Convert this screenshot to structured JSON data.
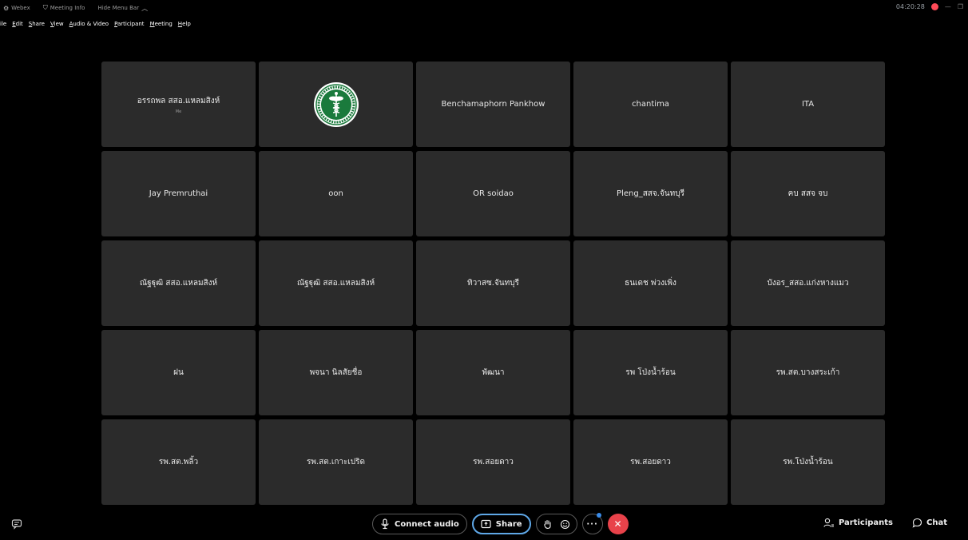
{
  "titlebar": {
    "app_name": "Webex",
    "meeting_info": "Meeting Info",
    "hide_menu_bar": "Hide Menu Bar",
    "clock": "04:20:28"
  },
  "menu": [
    {
      "first": "F",
      "rest": "ile"
    },
    {
      "first": "E",
      "rest": "dit"
    },
    {
      "first": "S",
      "rest": "hare"
    },
    {
      "first": "V",
      "rest": "iew"
    },
    {
      "first": "A",
      "rest": "udio & Video"
    },
    {
      "first": "P",
      "rest": "articipant"
    },
    {
      "first": "M",
      "rest": "eeting"
    },
    {
      "first": "H",
      "rest": "elp"
    }
  ],
  "tiles": [
    {
      "name": "อรรถพล สสอ.แหลมสิงห์",
      "sub": "Me"
    },
    {
      "name": "",
      "logo": "moph-logo"
    },
    {
      "name": "Benchamaphorn Pankhow"
    },
    {
      "name": "chantima"
    },
    {
      "name": "ITA"
    },
    {
      "name": "Jay Premruthai"
    },
    {
      "name": "oon"
    },
    {
      "name": "OR soidao"
    },
    {
      "name": "Pleng_สสจ.จันทบุรี"
    },
    {
      "name": "คบ สสจ จบ"
    },
    {
      "name": "ณัฐฐุฒิ สสอ.แหลมสิงห์"
    },
    {
      "name": "ณัฐฐุฒิ สสอ.แหลมสิงห์"
    },
    {
      "name": "ทิวาสซ.จันทบุรี"
    },
    {
      "name": "ธนเดช พ่วงเพิ่ง"
    },
    {
      "name": "บังอร_สสอ.แก่งหางแมว"
    },
    {
      "name": "ฝน"
    },
    {
      "name": "พจนา นิลสัยชื่อ"
    },
    {
      "name": "พัฒนา"
    },
    {
      "name": "รพ โป่งน้ำร้อน"
    },
    {
      "name": "รพ.สต.บางสระเก้า"
    },
    {
      "name": "รพ.สต.พลิ้ว"
    },
    {
      "name": "รพ.สต.เกาะเปริด"
    },
    {
      "name": "รพ.สอยดาว"
    },
    {
      "name": "รพ.สอยดาว"
    },
    {
      "name": "รพ.โป่งน้ำร้อน"
    }
  ],
  "toolbar": {
    "connect_audio": "Connect audio",
    "share": "Share",
    "participants": "Participants",
    "chat": "Chat"
  },
  "colors": {
    "tile_bg": "#2b2b2b",
    "end_call": "#e8424a",
    "share_border": "#5fa8e8",
    "record": "#ff4a57"
  }
}
